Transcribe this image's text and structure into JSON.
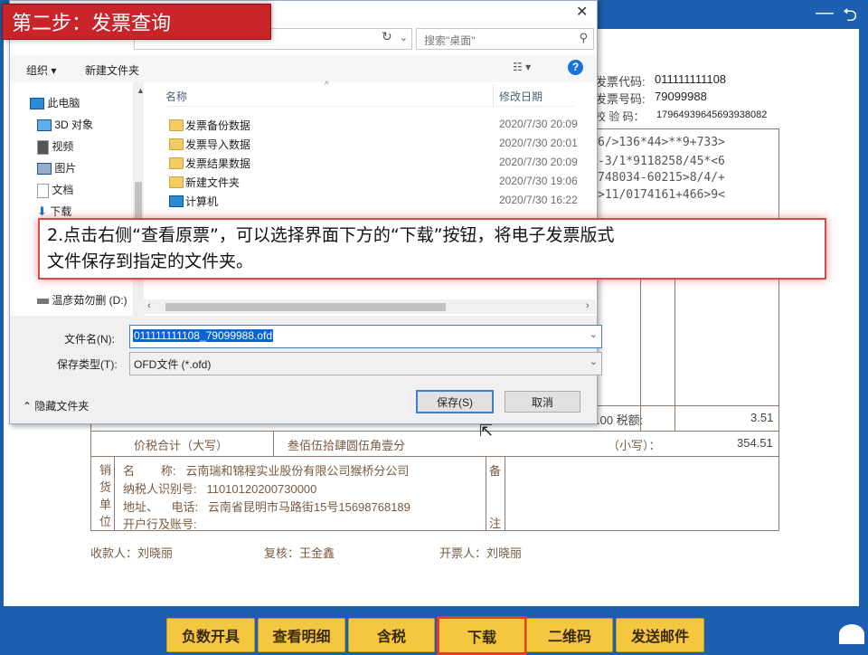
{
  "banner": {
    "title": "第二步：发票查询"
  },
  "dialog": {
    "search_placeholder": "搜索\"桌面\"",
    "toolbar": {
      "organize": "组织 ▾",
      "new_folder": "新建文件夹"
    },
    "nav_items": [
      "此电脑",
      "3D 对象",
      "视频",
      "图片",
      "文档",
      "下载",
      "温彦茹勿删 (D:)"
    ],
    "columns": {
      "name": "名称",
      "date": "修改日期"
    },
    "files": [
      {
        "name": "发票备份数据",
        "date": "2020/7/30 20:09",
        "icon": "folder"
      },
      {
        "name": "发票导入数据",
        "date": "2020/7/30 20:01",
        "icon": "folder"
      },
      {
        "name": "发票结果数据",
        "date": "2020/7/30 20:09",
        "icon": "folder"
      },
      {
        "name": "新建文件夹",
        "date": "2020/7/30 19:06",
        "icon": "folder"
      },
      {
        "name": "计算机",
        "date": "2020/7/30 16:22",
        "icon": "computer"
      }
    ],
    "filename_label": "文件名(N):",
    "filename_value": "011111111108_79099988.ofd",
    "filetype_label": "保存类型(T):",
    "filetype_value": "OFD文件 (*.ofd)",
    "hide_folders": "隐藏文件夹",
    "save_button": "保存(S)",
    "cancel_button": "取消"
  },
  "note": {
    "line1": "2.点击右侧“查看原票”，可以选择界面下方的“下载”按钮，将电子发票版式",
    "line2": "文件保存到指定的文件夹。"
  },
  "invoice": {
    "code_label": "发票代码:",
    "code_value": "011111111108",
    "number_label": "发票号码:",
    "number_value": "79099988",
    "check_label": "校 验 码：",
    "check_value": "17964939645693938082",
    "cipher": [
      "6/>136*44>**9+733>",
      "-3/1*9118258/45*<6",
      "748034-60215>8/4/+",
      ">11/0174161+466>9<"
    ],
    "tax_amount_label": ".00  税额:",
    "tax_amount_value": "3.51",
    "total_label": "价税合计（大写）",
    "total_words": "叁佰伍拾肆圆伍角壹分",
    "total_small_label": "（小写）：",
    "total_small_value": "354.51",
    "seller_side": [
      "销",
      "货",
      "单",
      "位"
    ],
    "seller_name": "名        称:   云南瑞和锦程实业股份有限公司猴桥分公司",
    "seller_tax_id": "纳税人识别号:   11010120200730000",
    "seller_addr": "地址、    电话:   云南省昆明市马路街15号15698768189",
    "seller_bank": "开户行及账号:",
    "remark_side": [
      "备",
      "注"
    ],
    "payee": "收款人：刘晓丽",
    "reviewer": "复核：王金鑫",
    "drawer": "开票人：刘晓丽"
  },
  "bottom_buttons": [
    "负数开具",
    "查看明细",
    "含税",
    "下载",
    "二维码",
    "发送邮件"
  ]
}
